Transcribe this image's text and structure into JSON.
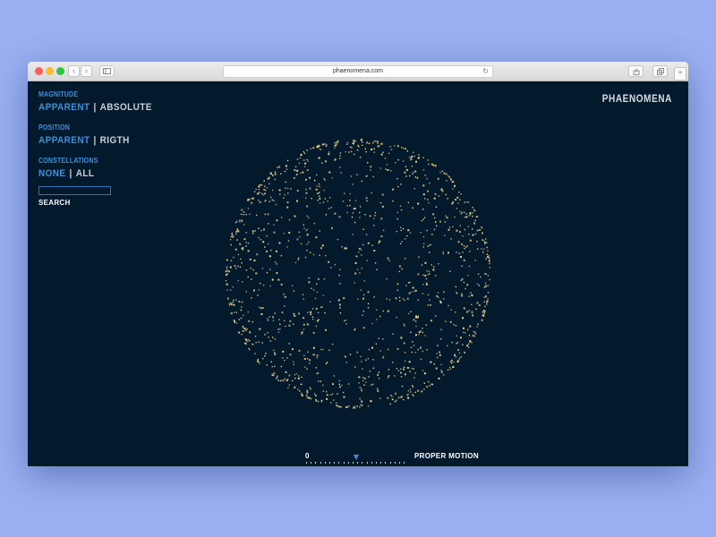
{
  "browser": {
    "url": "phaenomena.com"
  },
  "brand": "PHAENOMENA",
  "panel": {
    "magnitude": {
      "label": "MAGNITUDE",
      "options": [
        "APPARENT",
        "ABSOLUTE"
      ],
      "selected": "APPARENT"
    },
    "position": {
      "label": "POSITION",
      "options": [
        "APPARENT",
        "RIGTH"
      ],
      "selected": "APPARENT"
    },
    "constellations": {
      "label": "CONSTELLATIONS",
      "options": [
        "NONE",
        "ALL"
      ],
      "selected": "NONE"
    },
    "search": {
      "value": "",
      "button_label": "SEARCH"
    }
  },
  "slider": {
    "min_label": "0",
    "label": "PROPER MOTION",
    "position_fraction": 0.5
  },
  "colors": {
    "background": "#021a2c",
    "accent": "#3f8fd8",
    "star": "#f6d58e",
    "inactive_text": "#c9cfd6"
  },
  "icons": {
    "back": "chevron-left-icon",
    "forward": "chevron-right-icon",
    "sidebar": "sidebar-icon",
    "reload": "reload-icon",
    "share": "share-icon",
    "tabs": "tabs-icon",
    "new_tab": "plus-icon"
  }
}
